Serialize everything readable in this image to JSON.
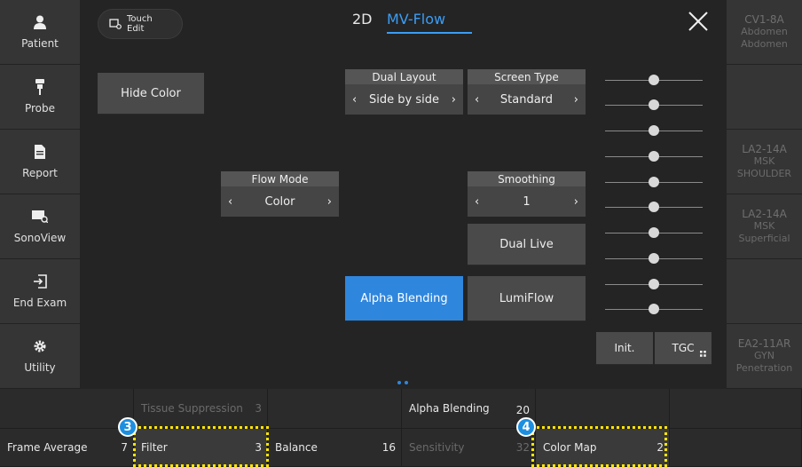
{
  "left_nav": [
    {
      "label": "Patient",
      "icon": "person-icon"
    },
    {
      "label": "Probe",
      "icon": "probe-icon"
    },
    {
      "label": "Report",
      "icon": "document-icon"
    },
    {
      "label": "SonoView",
      "icon": "sonoview-icon"
    },
    {
      "label": "End Exam",
      "icon": "exit-icon"
    },
    {
      "label": "Utility",
      "icon": "gear-icon"
    }
  ],
  "right_presets": [
    {
      "line1": "CV1-8A",
      "line2": "Abdomen",
      "line3": "Abdomen"
    },
    {
      "line1": "",
      "line2": "",
      "line3": ""
    },
    {
      "line1": "LA2-14A",
      "line2": "MSK",
      "line3": "SHOULDER"
    },
    {
      "line1": "LA2-14A",
      "line2": "MSK",
      "line3": "Superficial"
    },
    {
      "line1": "",
      "line2": "",
      "line3": ""
    },
    {
      "line1": "EA2-11AR",
      "line2": "GYN",
      "line3": "Penetration"
    }
  ],
  "header": {
    "touch_edit_line1": "Touch",
    "touch_edit_line2": "Edit",
    "tab_2d": "2D",
    "tab_mvflow": "MV-Flow"
  },
  "controls": {
    "hide_color": "Hide Color",
    "dual_layout": {
      "label": "Dual Layout",
      "value": "Side by side"
    },
    "screen_type": {
      "label": "Screen Type",
      "value": "Standard"
    },
    "flow_mode": {
      "label": "Flow Mode",
      "value": "Color"
    },
    "smoothing": {
      "label": "Smoothing",
      "value": "1"
    },
    "dual_live": "Dual Live",
    "alpha_blending": "Alpha Blending",
    "lumiflow": "LumiFlow",
    "init": "Init.",
    "tgc": "TGC",
    "prev_glyph": "‹",
    "next_glyph": "›"
  },
  "bottom_bar": {
    "top_row": [
      {
        "name": "Tissue Suppression",
        "value": "3",
        "dim": true
      },
      {
        "name": "Alpha Blending",
        "value": "20",
        "dim": false
      }
    ],
    "bottom_row": [
      {
        "name": "Frame Average",
        "value": "7"
      },
      {
        "name": "Filter",
        "value": "3"
      },
      {
        "name": "Balance",
        "value": "16"
      },
      {
        "name": "Sensitivity",
        "value": "32"
      },
      {
        "name": "Color Map",
        "value": "2"
      }
    ],
    "badges": [
      "3",
      "4"
    ]
  },
  "colors": {
    "accent": "#2f86dd",
    "highlight": "#ffe600",
    "badge": "#1d8fe0"
  }
}
